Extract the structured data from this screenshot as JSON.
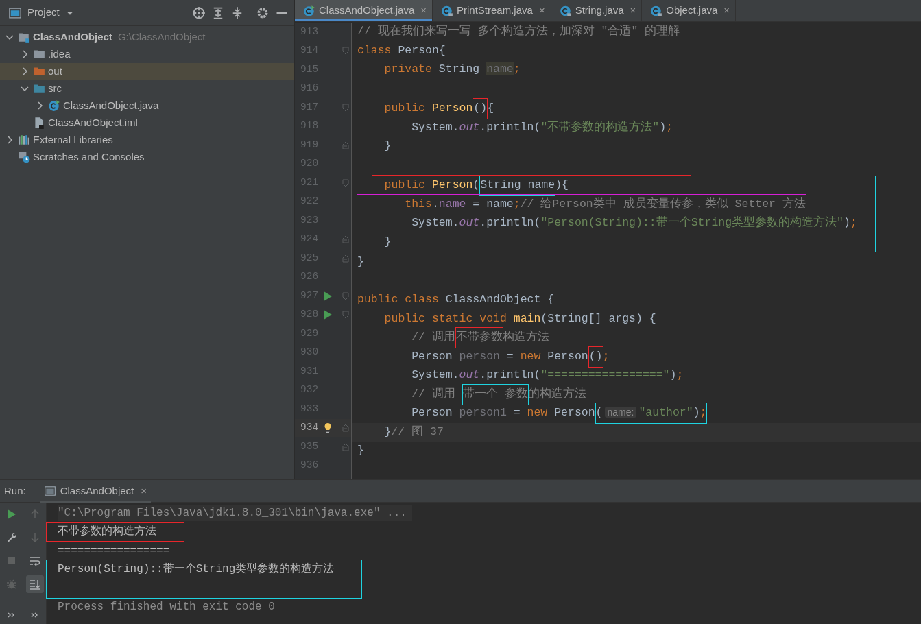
{
  "project_panel": {
    "title": "Project",
    "tree": [
      {
        "label": "ClassAndObject",
        "path": "G:\\ClassAndObject",
        "kind": "module-folder",
        "bold": true,
        "expanded": true,
        "selected": false,
        "children": [
          {
            "label": ".idea",
            "kind": "folder",
            "expanded": false,
            "selected": false
          },
          {
            "label": "out",
            "kind": "excluded-folder",
            "expanded": false,
            "selected": true
          },
          {
            "label": "src",
            "kind": "source-folder",
            "expanded": true,
            "selected": false,
            "children": [
              {
                "label": "ClassAndObject.java",
                "kind": "class-run",
                "expanded": false,
                "selected": false
              }
            ]
          },
          {
            "label": "ClassAndObject.iml",
            "kind": "iml-file",
            "selected": false
          }
        ]
      },
      {
        "label": "External Libraries",
        "kind": "libraries",
        "expanded": false,
        "selected": false
      },
      {
        "label": "Scratches and Consoles",
        "kind": "scratches",
        "selected": false
      }
    ]
  },
  "editor_tabs": [
    {
      "label": "ClassAndObject.java",
      "kind": "class-run",
      "close": "×",
      "selected": true
    },
    {
      "label": "PrintStream.java",
      "kind": "class-lock",
      "close": "×",
      "selected": false
    },
    {
      "label": "String.java",
      "kind": "class-lock",
      "close": "×",
      "selected": false
    },
    {
      "label": "Object.java",
      "kind": "class-lock",
      "close": "×",
      "selected": false
    }
  ],
  "editor": {
    "lines": [
      {
        "number": "913",
        "current": false,
        "tokens": [
          {
            "kind": "comment",
            "text": "// 现在我们来写一写 多个构造方法，加深对 \"合适\" 的理解"
          }
        ]
      },
      {
        "number": "914",
        "current": false,
        "markers": [
          {
            "kind": "fold"
          }
        ],
        "tokens": [
          {
            "kind": "keyword",
            "text": "class "
          },
          {
            "kind": "plain",
            "text": "Person{"
          }
        ]
      },
      {
        "number": "915",
        "current": false,
        "tokens": [
          {
            "kind": "keyword",
            "text": "    private "
          },
          {
            "kind": "plain",
            "text": "String "
          },
          {
            "kind": "unused-field",
            "text": "name"
          },
          {
            "kind": "keyword",
            "text": ";"
          }
        ]
      },
      {
        "number": "916",
        "current": false
      },
      {
        "kind": "frame",
        "color": "#e8262b",
        "lines": [
          {
            "number": "917",
            "current": false,
            "markers": [
              {
                "kind": "fold"
              }
            ],
            "tokens": [
              {
                "kind": "keyword",
                "text": "    public "
              },
              {
                "kind": "method",
                "text": "Person"
              },
              {
                "kind": "group",
                "color": "#e8262b",
                "tokens": [
                  {
                    "kind": "plain",
                    "text": "()"
                  }
                ]
              },
              {
                "kind": "plain",
                "text": "{"
              }
            ]
          },
          {
            "number": "918",
            "current": false,
            "tokens": [
              {
                "kind": "plain",
                "text": "        System."
              },
              {
                "kind": "static-field",
                "text": "out"
              },
              {
                "kind": "plain",
                "text": ".println("
              },
              {
                "kind": "string",
                "text": "\"不带参数的构造方法\""
              },
              {
                "kind": "plain",
                "text": ")"
              },
              {
                "kind": "keyword",
                "text": ";"
              }
            ]
          },
          {
            "number": "919",
            "current": false,
            "markers": [
              {
                "kind": "fold-end"
              }
            ],
            "tokens": [
              {
                "kind": "plain",
                "text": "    }"
              }
            ]
          },
          {
            "number": "920",
            "current": false
          }
        ]
      },
      {
        "kind": "frame",
        "color": "#1fd3e0",
        "lines": [
          {
            "number": "921",
            "current": false,
            "markers": [
              {
                "kind": "fold"
              }
            ],
            "tokens": [
              {
                "kind": "keyword",
                "text": "    public "
              },
              {
                "kind": "method",
                "text": "Person"
              },
              {
                "kind": "plain",
                "text": "("
              },
              {
                "kind": "group",
                "color": "#1fd3e0",
                "tokens": [
                  {
                    "kind": "plain",
                    "text": "String name"
                  }
                ]
              },
              {
                "kind": "plain",
                "text": "){"
              }
            ]
          },
          {
            "number": "922",
            "current": false,
            "tokens": [
              {
                "kind": "group",
                "color": "#d61fd6",
                "tokens": [
                  {
                    "kind": "keyword",
                    "text": "       this"
                  },
                  {
                    "kind": "plain",
                    "text": "."
                  },
                  {
                    "kind": "field",
                    "text": "name"
                  },
                  {
                    "kind": "plain",
                    "text": " = name"
                  },
                  {
                    "kind": "keyword",
                    "text": ";"
                  },
                  {
                    "kind": "comment",
                    "text": "// 给Person类中 成员变量传参，类似 Setter 方法"
                  }
                ]
              }
            ]
          },
          {
            "number": "923",
            "current": false,
            "tokens": [
              {
                "kind": "plain",
                "text": "        System."
              },
              {
                "kind": "static-field",
                "text": "out"
              },
              {
                "kind": "plain",
                "text": ".println("
              },
              {
                "kind": "string",
                "text": "\"Person(String)::带一个String类型参数的构造方法\""
              },
              {
                "kind": "plain",
                "text": ")"
              },
              {
                "kind": "keyword",
                "text": ";"
              }
            ]
          },
          {
            "number": "924",
            "current": false,
            "markers": [
              {
                "kind": "fold-end"
              }
            ],
            "tokens": [
              {
                "kind": "plain",
                "text": "    }"
              }
            ]
          }
        ]
      },
      {
        "number": "925",
        "current": false,
        "markers": [
          {
            "kind": "fold-end"
          }
        ],
        "tokens": [
          {
            "kind": "plain",
            "text": "}"
          }
        ]
      },
      {
        "number": "926",
        "current": false
      },
      {
        "number": "927",
        "current": false,
        "markers": [
          {
            "kind": "run"
          },
          {
            "kind": "fold"
          }
        ],
        "tokens": [
          {
            "kind": "keyword",
            "text": "public class "
          },
          {
            "kind": "plain",
            "text": "ClassAndObject {"
          }
        ]
      },
      {
        "number": "928",
        "current": false,
        "markers": [
          {
            "kind": "run"
          },
          {
            "kind": "fold"
          }
        ],
        "tokens": [
          {
            "kind": "keyword",
            "text": "    public static void "
          },
          {
            "kind": "method",
            "text": "main"
          },
          {
            "kind": "plain",
            "text": "(String[] args) {"
          }
        ]
      },
      {
        "number": "929",
        "current": false,
        "tokens": [
          {
            "kind": "comment",
            "text": "        // 调用"
          },
          {
            "kind": "group",
            "color": "#e8262b",
            "tokens": [
              {
                "kind": "comment",
                "text": "不带参数"
              }
            ]
          },
          {
            "kind": "comment",
            "text": "构造方法"
          }
        ]
      },
      {
        "number": "930",
        "current": false,
        "tokens": [
          {
            "kind": "plain",
            "text": "        Person "
          },
          {
            "kind": "unused",
            "text": "person"
          },
          {
            "kind": "plain",
            "text": " = "
          },
          {
            "kind": "keyword",
            "text": "new "
          },
          {
            "kind": "plain",
            "text": "Person"
          },
          {
            "kind": "group",
            "color": "#e8262b",
            "tokens": [
              {
                "kind": "plain",
                "text": "()"
              }
            ]
          },
          {
            "kind": "keyword",
            "text": ";"
          }
        ]
      },
      {
        "number": "931",
        "current": false,
        "tokens": [
          {
            "kind": "plain",
            "text": "        System."
          },
          {
            "kind": "static-field",
            "text": "out"
          },
          {
            "kind": "plain",
            "text": ".println("
          },
          {
            "kind": "string",
            "text": "\"=================\""
          },
          {
            "kind": "plain",
            "text": ")"
          },
          {
            "kind": "keyword",
            "text": ";"
          }
        ]
      },
      {
        "number": "932",
        "current": false,
        "tokens": [
          {
            "kind": "comment",
            "text": "        // 调用 "
          },
          {
            "kind": "group",
            "color": "#1fd3e0",
            "tokens": [
              {
                "kind": "comment",
                "text": "带一个 参数"
              }
            ]
          },
          {
            "kind": "comment",
            "text": "的构造方法"
          }
        ]
      },
      {
        "number": "933",
        "current": false,
        "tokens": [
          {
            "kind": "plain",
            "text": "        Person "
          },
          {
            "kind": "unused",
            "text": "person1"
          },
          {
            "kind": "plain",
            "text": " = "
          },
          {
            "kind": "keyword",
            "text": "new "
          },
          {
            "kind": "plain",
            "text": "Person"
          },
          {
            "kind": "group",
            "color": "#1fd3e0",
            "tokens": [
              {
                "kind": "plain",
                "text": "("
              },
              {
                "kind": "hint",
                "text": "name:"
              },
              {
                "kind": "string",
                "text": "\"author\""
              },
              {
                "kind": "plain",
                "text": ")"
              },
              {
                "kind": "keyword",
                "text": ";"
              }
            ]
          }
        ]
      },
      {
        "number": "934",
        "current": true,
        "markers": [
          {
            "kind": "bulb"
          },
          {
            "kind": "fold-end"
          }
        ],
        "tokens": [
          {
            "kind": "plain",
            "text": "    }"
          },
          {
            "kind": "comment",
            "text": "// 图 37"
          }
        ]
      },
      {
        "number": "935",
        "current": false,
        "markers": [
          {
            "kind": "fold-end"
          }
        ],
        "tokens": [
          {
            "kind": "plain",
            "text": "}"
          }
        ]
      },
      {
        "number": "936",
        "current": false
      }
    ]
  },
  "run_panel": {
    "label": "Run:",
    "tabs": [
      {
        "label": "ClassAndObject",
        "close": "×",
        "selected": true
      }
    ],
    "toolbar_left": [
      {
        "kind": "run",
        "disabled": false
      },
      {
        "kind": "wrench",
        "disabled": false
      },
      {
        "kind": "stop",
        "disabled": true
      },
      {
        "kind": "debug",
        "disabled": true
      },
      {
        "kind": "more",
        "disabled": false
      }
    ],
    "toolbar_right": [
      {
        "kind": "up",
        "disabled": true,
        "selected": false
      },
      {
        "kind": "down",
        "disabled": true,
        "selected": false
      },
      {
        "kind": "wrap",
        "disabled": false,
        "selected": false
      },
      {
        "kind": "scroll-end",
        "disabled": false,
        "selected": true
      },
      {
        "kind": "more",
        "disabled": false,
        "selected": false
      }
    ],
    "console": [
      {
        "kind": "command",
        "text": "\"C:\\Program Files\\Java\\jdk1.8.0_301\\bin\\java.exe\" ..."
      },
      {
        "kind": "frame",
        "color": "#e8262b",
        "lines": [
          {
            "kind": "output",
            "text": "不带参数的构造方法"
          }
        ]
      },
      {
        "kind": "output",
        "text": "================="
      },
      {
        "kind": "frame",
        "color": "#1fd3e0",
        "lines": [
          {
            "kind": "output",
            "text": "Person(String)::带一个String类型参数的构造方法"
          }
        ]
      },
      {
        "kind": "process",
        "text": "Process finished with exit code 0"
      }
    ]
  }
}
